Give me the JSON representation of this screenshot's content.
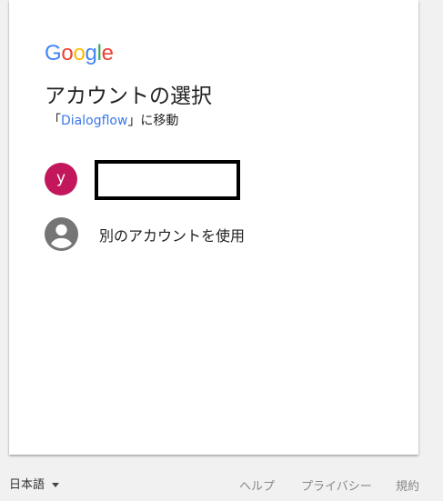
{
  "logo": {
    "letters": [
      "G",
      "o",
      "o",
      "g",
      "l",
      "e"
    ],
    "colors": [
      "#4285f4",
      "#ea4335",
      "#fbbc05",
      "#4285f4",
      "#34a853",
      "#ea4335"
    ]
  },
  "title": "アカウントの選択",
  "subtitle": {
    "prefix": "「",
    "app_name": "Dialogflow",
    "suffix": "」に移動"
  },
  "accounts": [
    {
      "avatar_letter": "y",
      "avatar_color": "#c2185b"
    }
  ],
  "other_account": {
    "label": "別のアカウントを使用",
    "icon": "account-circle-icon"
  },
  "footer": {
    "language": "日本語",
    "help": "ヘルプ",
    "privacy": "プライバシー",
    "terms": "規約"
  }
}
